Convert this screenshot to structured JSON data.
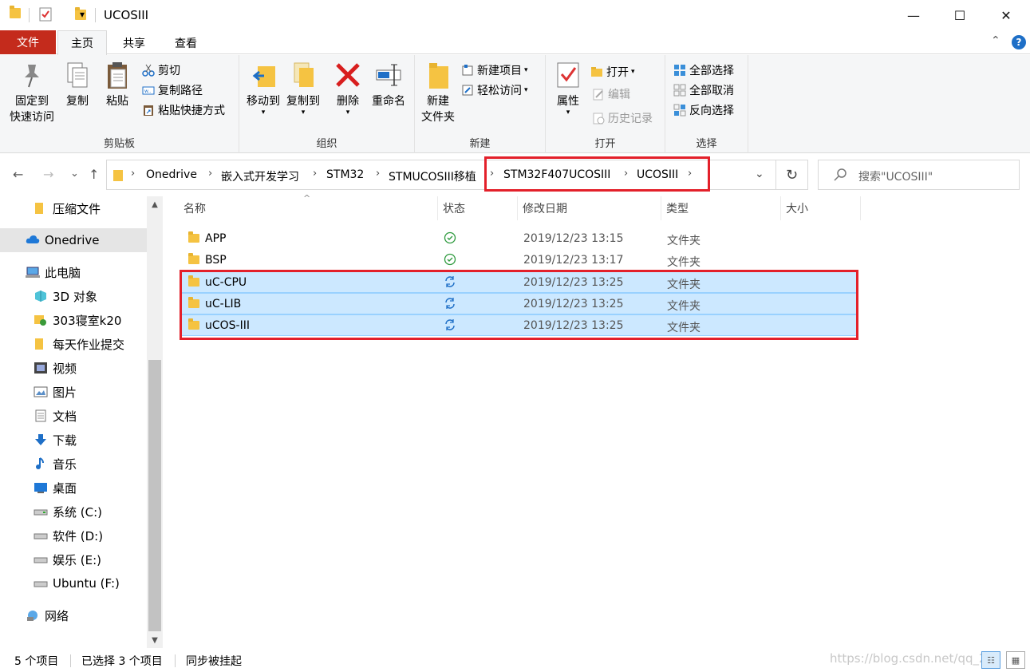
{
  "window": {
    "title": "UCOSIII",
    "qat_dropdown": "▾",
    "minimize": "—",
    "maximize": "☐",
    "close": "✕"
  },
  "ribbon_tabs": {
    "file": "文件",
    "home": "主页",
    "share": "共享",
    "view": "查看",
    "collapse": "⌃",
    "help": "?"
  },
  "ribbon": {
    "clipboard": {
      "label": "剪贴板",
      "pin_line1": "固定到",
      "pin_line2": "快速访问",
      "copy": "复制",
      "paste": "粘贴",
      "cut": "剪切",
      "copy_path": "复制路径",
      "paste_shortcut": "粘贴快捷方式"
    },
    "organize": {
      "label": "组织",
      "move_to": "移动到",
      "copy_to": "复制到",
      "delete": "删除",
      "rename": "重命名"
    },
    "new": {
      "label": "新建",
      "new_folder_line1": "新建",
      "new_folder_line2": "文件夹",
      "new_item": "新建项目",
      "easy_access": "轻松访问"
    },
    "open": {
      "label": "打开",
      "properties": "属性",
      "open": "打开",
      "edit": "编辑",
      "history": "历史记录"
    },
    "select": {
      "label": "选择",
      "select_all": "全部选择",
      "select_none": "全部取消",
      "invert": "反向选择"
    }
  },
  "nav": {
    "back": "←",
    "forward": "→",
    "recent": "⌄",
    "up": "↑"
  },
  "breadcrumb": [
    "Onedrive",
    "嵌入式开发学习",
    "STM32",
    "STMUCOSIII移植",
    "STM32F407UCOSIII",
    "UCOSIII"
  ],
  "address_dropdown": "⌄",
  "refresh": "↻",
  "search": {
    "placeholder": "搜索\"UCOSIII\""
  },
  "sidebar": {
    "items": [
      {
        "label": "压缩文件",
        "icon": "folder-icon"
      },
      {
        "label": "Onedrive",
        "icon": "cloud-icon"
      },
      {
        "label": "此电脑",
        "icon": "computer-icon"
      },
      {
        "label": "3D 对象",
        "icon": "cube-icon"
      },
      {
        "label": "303寝室k20",
        "icon": "network-drive-icon"
      },
      {
        "label": "每天作业提交",
        "icon": "folder-icon"
      },
      {
        "label": "视频",
        "icon": "video-icon"
      },
      {
        "label": "图片",
        "icon": "picture-icon"
      },
      {
        "label": "文档",
        "icon": "document-icon"
      },
      {
        "label": "下载",
        "icon": "download-icon"
      },
      {
        "label": "音乐",
        "icon": "music-icon"
      },
      {
        "label": "桌面",
        "icon": "desktop-icon"
      },
      {
        "label": "系统 (C:)",
        "icon": "drive-icon"
      },
      {
        "label": "软件 (D:)",
        "icon": "drive-icon"
      },
      {
        "label": "娱乐 (E:)",
        "icon": "drive-icon"
      },
      {
        "label": "Ubuntu (F:)",
        "icon": "drive-icon"
      },
      {
        "label": "网络",
        "icon": "network-icon"
      }
    ]
  },
  "columns": {
    "name": "名称",
    "status": "状态",
    "modified": "修改日期",
    "type": "类型",
    "size": "大小"
  },
  "files": [
    {
      "name": "APP",
      "status": "synced",
      "date": "2019/12/23 13:15",
      "type": "文件夹",
      "selected": false
    },
    {
      "name": "BSP",
      "status": "synced",
      "date": "2019/12/23 13:17",
      "type": "文件夹",
      "selected": false
    },
    {
      "name": "uC-CPU",
      "status": "syncing",
      "date": "2019/12/23 13:25",
      "type": "文件夹",
      "selected": true
    },
    {
      "name": "uC-LIB",
      "status": "syncing",
      "date": "2019/12/23 13:25",
      "type": "文件夹",
      "selected": true
    },
    {
      "name": "uCOS-III",
      "status": "syncing",
      "date": "2019/12/23 13:25",
      "type": "文件夹",
      "selected": true
    }
  ],
  "statusbar": {
    "count": "5 个项目",
    "selected": "已选择 3 个项目",
    "sync": "同步被挂起",
    "watermark": "https://blog.csdn.net/qq_25"
  },
  "colors": {
    "file_tab": "#c42b1c",
    "selection": "#cce8ff",
    "annotation_red": "#e3202a",
    "sync_green": "#2e9a3e",
    "sync_blue": "#1e6fc7"
  }
}
